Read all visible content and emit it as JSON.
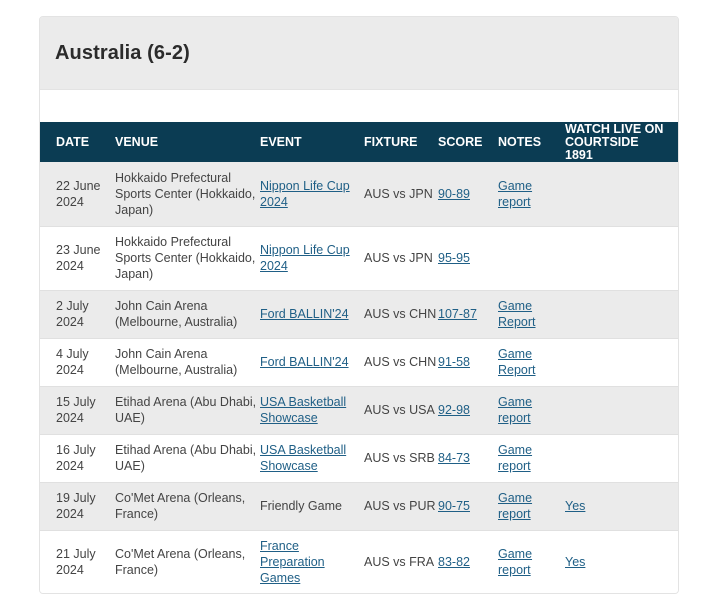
{
  "page": {
    "title": "Australia (6-2)"
  },
  "table": {
    "headers": {
      "date": "DATE",
      "venue": "VENUE",
      "event": "EVENT",
      "fixture": "FIXTURE",
      "score": "SCORE",
      "notes": "NOTES",
      "live": "WATCH LIVE ON COURTSIDE 1891"
    },
    "rows": [
      {
        "date": "22 June 2024",
        "venue": "Hokkaido Prefectural Sports Center (Hokkaido, Japan)",
        "event": "Nippon Life Cup 2024",
        "fixture": "AUS vs JPN",
        "score": "90-89",
        "notes": "Game report",
        "live": ""
      },
      {
        "date": "23 June 2024",
        "venue": "Hokkaido Prefectural Sports Center (Hokkaido, Japan)",
        "event": "Nippon Life Cup 2024",
        "fixture": "AUS vs JPN",
        "score": "95-95",
        "notes": "",
        "live": ""
      },
      {
        "date": "2 July 2024",
        "venue": "John Cain Arena (Melbourne, Australia)",
        "event": "Ford BALLIN'24",
        "fixture": "AUS vs CHN",
        "score": "107-87",
        "notes": "Game Report",
        "live": ""
      },
      {
        "date": "4 July 2024",
        "venue": "John Cain Arena (Melbourne, Australia)",
        "event": "Ford BALLIN'24",
        "fixture": "AUS vs CHN",
        "score": "91-58",
        "notes": "Game Report",
        "live": ""
      },
      {
        "date": "15 July 2024",
        "venue": "Etihad Arena (Abu Dhabi, UAE)",
        "event": "USA Basketball Showcase",
        "fixture": "AUS vs USA",
        "score": "92-98",
        "notes": "Game report",
        "live": ""
      },
      {
        "date": "16 July 2024",
        "venue": "Etihad Arena (Abu Dhabi, UAE)",
        "event": "USA Basketball Showcase",
        "fixture": "AUS vs SRB",
        "score": "84-73",
        "notes": "Game report",
        "live": ""
      },
      {
        "date": "19 July 2024",
        "venue": "Co'Met Arena (Orleans, France)",
        "event": "Friendly Game",
        "fixture": "AUS vs PUR",
        "score": "90-75",
        "notes": "Game report",
        "live": "Yes"
      },
      {
        "date": "21 July 2024",
        "venue": "Co'Met Arena (Orleans, France)",
        "event": "France Preparation Games",
        "fixture": "AUS vs FRA",
        "score": "83-82",
        "notes": "Game report",
        "live": "Yes"
      }
    ]
  },
  "colors": {
    "header_bg": "#0b3c53",
    "banner_bg": "#ebebeb",
    "link": "#1f5f86",
    "stripe": "#ebebeb"
  }
}
